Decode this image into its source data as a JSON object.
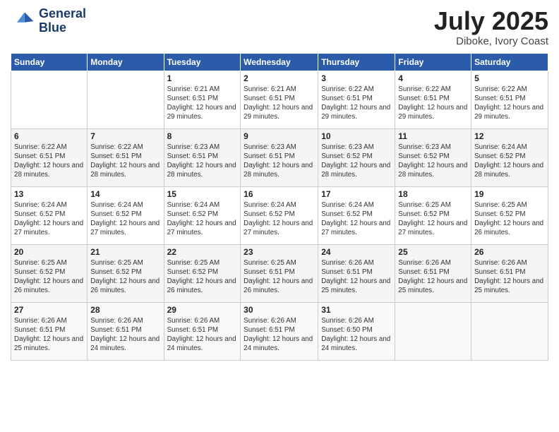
{
  "header": {
    "logo_line1": "General",
    "logo_line2": "Blue",
    "month": "July 2025",
    "location": "Diboke, Ivory Coast"
  },
  "days_of_week": [
    "Sunday",
    "Monday",
    "Tuesday",
    "Wednesday",
    "Thursday",
    "Friday",
    "Saturday"
  ],
  "weeks": [
    [
      {
        "day": "",
        "info": ""
      },
      {
        "day": "",
        "info": ""
      },
      {
        "day": "1",
        "info": "Sunrise: 6:21 AM\nSunset: 6:51 PM\nDaylight: 12 hours and 29 minutes."
      },
      {
        "day": "2",
        "info": "Sunrise: 6:21 AM\nSunset: 6:51 PM\nDaylight: 12 hours and 29 minutes."
      },
      {
        "day": "3",
        "info": "Sunrise: 6:22 AM\nSunset: 6:51 PM\nDaylight: 12 hours and 29 minutes."
      },
      {
        "day": "4",
        "info": "Sunrise: 6:22 AM\nSunset: 6:51 PM\nDaylight: 12 hours and 29 minutes."
      },
      {
        "day": "5",
        "info": "Sunrise: 6:22 AM\nSunset: 6:51 PM\nDaylight: 12 hours and 29 minutes."
      }
    ],
    [
      {
        "day": "6",
        "info": "Sunrise: 6:22 AM\nSunset: 6:51 PM\nDaylight: 12 hours and 28 minutes."
      },
      {
        "day": "7",
        "info": "Sunrise: 6:22 AM\nSunset: 6:51 PM\nDaylight: 12 hours and 28 minutes."
      },
      {
        "day": "8",
        "info": "Sunrise: 6:23 AM\nSunset: 6:51 PM\nDaylight: 12 hours and 28 minutes."
      },
      {
        "day": "9",
        "info": "Sunrise: 6:23 AM\nSunset: 6:51 PM\nDaylight: 12 hours and 28 minutes."
      },
      {
        "day": "10",
        "info": "Sunrise: 6:23 AM\nSunset: 6:52 PM\nDaylight: 12 hours and 28 minutes."
      },
      {
        "day": "11",
        "info": "Sunrise: 6:23 AM\nSunset: 6:52 PM\nDaylight: 12 hours and 28 minutes."
      },
      {
        "day": "12",
        "info": "Sunrise: 6:24 AM\nSunset: 6:52 PM\nDaylight: 12 hours and 28 minutes."
      }
    ],
    [
      {
        "day": "13",
        "info": "Sunrise: 6:24 AM\nSunset: 6:52 PM\nDaylight: 12 hours and 27 minutes."
      },
      {
        "day": "14",
        "info": "Sunrise: 6:24 AM\nSunset: 6:52 PM\nDaylight: 12 hours and 27 minutes."
      },
      {
        "day": "15",
        "info": "Sunrise: 6:24 AM\nSunset: 6:52 PM\nDaylight: 12 hours and 27 minutes."
      },
      {
        "day": "16",
        "info": "Sunrise: 6:24 AM\nSunset: 6:52 PM\nDaylight: 12 hours and 27 minutes."
      },
      {
        "day": "17",
        "info": "Sunrise: 6:24 AM\nSunset: 6:52 PM\nDaylight: 12 hours and 27 minutes."
      },
      {
        "day": "18",
        "info": "Sunrise: 6:25 AM\nSunset: 6:52 PM\nDaylight: 12 hours and 27 minutes."
      },
      {
        "day": "19",
        "info": "Sunrise: 6:25 AM\nSunset: 6:52 PM\nDaylight: 12 hours and 26 minutes."
      }
    ],
    [
      {
        "day": "20",
        "info": "Sunrise: 6:25 AM\nSunset: 6:52 PM\nDaylight: 12 hours and 26 minutes."
      },
      {
        "day": "21",
        "info": "Sunrise: 6:25 AM\nSunset: 6:52 PM\nDaylight: 12 hours and 26 minutes."
      },
      {
        "day": "22",
        "info": "Sunrise: 6:25 AM\nSunset: 6:52 PM\nDaylight: 12 hours and 26 minutes."
      },
      {
        "day": "23",
        "info": "Sunrise: 6:25 AM\nSunset: 6:51 PM\nDaylight: 12 hours and 26 minutes."
      },
      {
        "day": "24",
        "info": "Sunrise: 6:26 AM\nSunset: 6:51 PM\nDaylight: 12 hours and 25 minutes."
      },
      {
        "day": "25",
        "info": "Sunrise: 6:26 AM\nSunset: 6:51 PM\nDaylight: 12 hours and 25 minutes."
      },
      {
        "day": "26",
        "info": "Sunrise: 6:26 AM\nSunset: 6:51 PM\nDaylight: 12 hours and 25 minutes."
      }
    ],
    [
      {
        "day": "27",
        "info": "Sunrise: 6:26 AM\nSunset: 6:51 PM\nDaylight: 12 hours and 25 minutes."
      },
      {
        "day": "28",
        "info": "Sunrise: 6:26 AM\nSunset: 6:51 PM\nDaylight: 12 hours and 24 minutes."
      },
      {
        "day": "29",
        "info": "Sunrise: 6:26 AM\nSunset: 6:51 PM\nDaylight: 12 hours and 24 minutes."
      },
      {
        "day": "30",
        "info": "Sunrise: 6:26 AM\nSunset: 6:51 PM\nDaylight: 12 hours and 24 minutes."
      },
      {
        "day": "31",
        "info": "Sunrise: 6:26 AM\nSunset: 6:50 PM\nDaylight: 12 hours and 24 minutes."
      },
      {
        "day": "",
        "info": ""
      },
      {
        "day": "",
        "info": ""
      }
    ]
  ]
}
